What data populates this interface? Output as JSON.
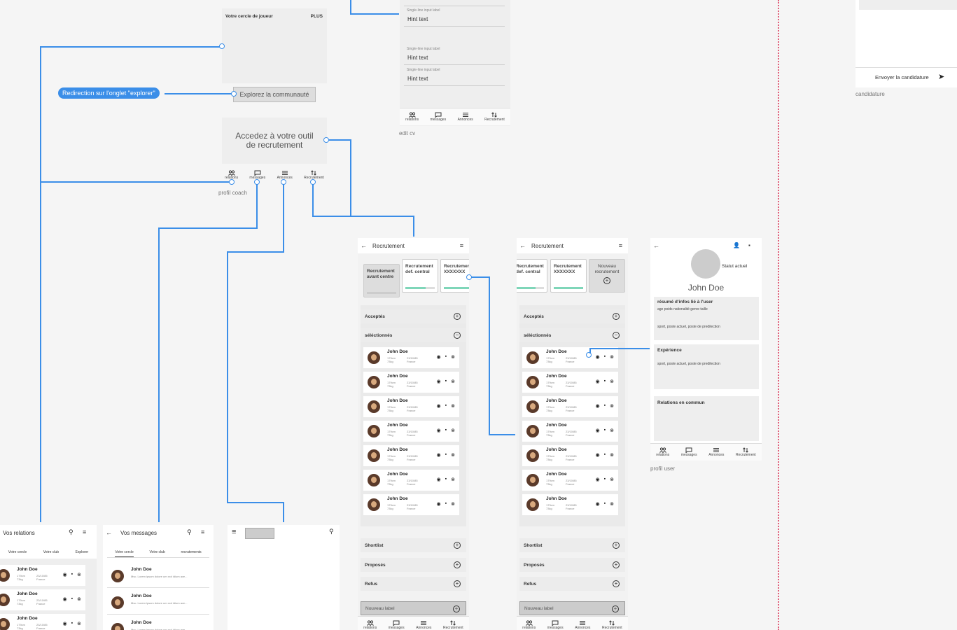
{
  "nav": {
    "relations": "relations",
    "messages": "messages",
    "annonces": "Annonces",
    "recrutement": "Recrutement"
  },
  "coach": {
    "cercle_title": "Votre cercle de joueur",
    "cercle_more": "PLUS",
    "explore_button": "Explorez la communauté",
    "tool_text": "Accedez à votre outil de recrutement",
    "caption": "profil coach"
  },
  "redirect_label": "Redirection sur l'onglet \"explorer\"",
  "editcv": {
    "field_label": "Single-line input label",
    "hint": "Hint text",
    "caption": "edit cv"
  },
  "candidature": {
    "send": "Envoyer la candidature",
    "caption": "candidature"
  },
  "recrut": {
    "title": "Recrutement",
    "chips_a": [
      "Recrutement avant centre",
      "Recrutement def. central",
      "Recrutement XXXXXXX"
    ],
    "chips_b": [
      "Recrutement def. central",
      "Recrutement XXXXXXX",
      "Nouveau recrutement"
    ],
    "sections": {
      "acceptes": "Acceptés",
      "selectionnes": "séléctionnés",
      "shortlist": "Shortlist",
      "proposes": "Proposés",
      "refus": "Refus",
      "nouveau": "Nouveau label"
    }
  },
  "candidate": {
    "name": "John Doe",
    "meta1": "179cm",
    "meta2": "73kg",
    "date": "23/10/85",
    "country": "France"
  },
  "profile": {
    "statut": "Statut actuel",
    "name": "John Doe",
    "resume_title": "résumé d'infos lié à l'user",
    "resume_line": "age poids nationalité genre taille",
    "resume_line2": "sport, poste actuel, poste de predilection",
    "exp_title": "Expérience",
    "exp_line": "sport, poste actuel, poste de predilection",
    "rel_title": "Relations en commun",
    "caption": "profil user"
  },
  "relations": {
    "title": "Vos relations",
    "tabs": [
      "Votre cercle",
      "Votre club",
      "Explorer"
    ]
  },
  "messages": {
    "title": "Vos messages",
    "tabs": [
      "Votre cercle",
      "Votre club",
      "recrutements"
    ],
    "preview": "Msc. Lorem ipsum dolore um xxd idium ave..."
  },
  "colors": {
    "accent": "#3b8ee8",
    "progress": "#7fd6b9",
    "dashed": "#e0607a"
  }
}
